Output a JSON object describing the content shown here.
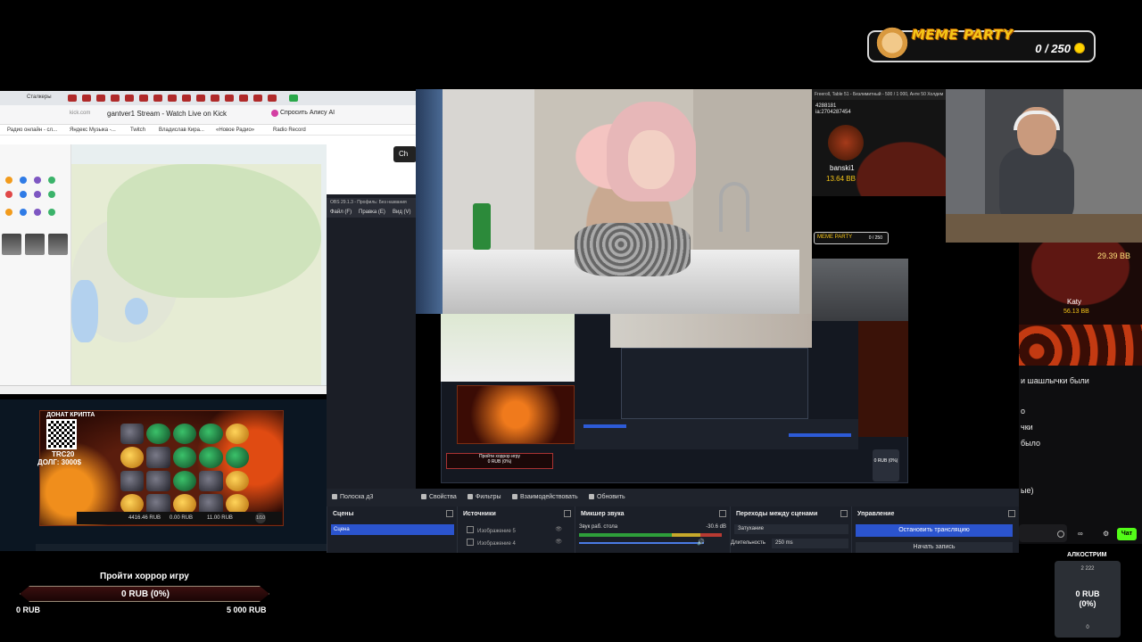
{
  "meme_party": {
    "title": "MEME PARTY",
    "count": "0 / 250"
  },
  "browser": {
    "tab_title": "Сталкеры",
    "url": "kick.com",
    "page_title": "gantver1 Stream - Watch Live on Kick",
    "alisa": "Спросить Алису AI",
    "bookmarks": [
      "Радио онлайн - сл...",
      "Яндекс Музыка -...",
      "Twitch",
      "Владислав Кира...",
      "«Новое Радио»",
      "Radio Record"
    ],
    "chat_button": "Ch"
  },
  "obs_app": {
    "title": "OBS 29.1.3 - Профиль: Без названия",
    "menu": [
      "Файл (F)",
      "Правка (E)",
      "Вид (V)"
    ]
  },
  "poker": {
    "header": "Freeroll, Table 51 - Безлимитный - 500 / 1 000, Анте 50 Холдем",
    "line1": "4288181",
    "line2": "ia:2704287454",
    "player": "banski1",
    "amount": "13.64 BB"
  },
  "roulette": {
    "amount": "29.39 BB",
    "player": "Katy",
    "amount2": "56.13 BB"
  },
  "chat": {
    "lines": [
      "и шашлычки были",
      "о",
      "чки",
      "было",
      "ые)"
    ],
    "send_label": "Чат"
  },
  "slot": {
    "donate_label": "ДОНАТ КРИПТА",
    "trc": "TRC20",
    "debt": "ДОЛГ: 3000$",
    "bar_values": [
      "4416.46 RUB",
      "0.00 RUB",
      "11.00 RUB",
      "1/10"
    ]
  },
  "preview": {
    "meme": "MEME PARTY",
    "meme_count": "0 / 250",
    "goal_title": "Пройти хоррор игру",
    "goal_value": "0 RUB (0%)",
    "box_value": "0 RUB (0%)"
  },
  "obs_bar": {
    "items": [
      "Свойства",
      "Фильтры",
      "Взаимодействовать",
      "Обновить"
    ],
    "hint": "Полоска д3"
  },
  "docks": {
    "scenes": {
      "title": "Сцены",
      "selected": "Сцена"
    },
    "sources": {
      "title": "Источники",
      "items": [
        "Изображение 5",
        "Изображение 4"
      ]
    },
    "mixer": {
      "title": "Микшер звука",
      "channel": "Звук раб. стола",
      "db": "-30.6 dB"
    },
    "transitions": {
      "title": "Переходы между сценами",
      "type": "Затухание",
      "duration_label": "Длительность",
      "duration": "250 ms"
    },
    "controls": {
      "title": "Управление",
      "stream": "Остановить трансляцию",
      "record": "Начать запись"
    }
  },
  "goal": {
    "title": "Пройти хоррор игру",
    "value": "0 RUB (0%)",
    "min": "0 RUB",
    "max": "5 000 RUB"
  },
  "alco": {
    "title": "АЛКОСТРИМ",
    "top": "2 222",
    "value_line1": "0 RUB",
    "value_line2": "(0%)",
    "foot": "0"
  }
}
